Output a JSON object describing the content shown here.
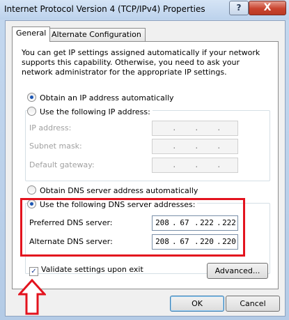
{
  "window": {
    "title": "Internet Protocol Version 4 (TCP/IPv4) Properties",
    "help_label": "?",
    "close_label": "X"
  },
  "tabs": [
    {
      "label": "General",
      "active": true
    },
    {
      "label": "Alternate Configuration",
      "active": false
    }
  ],
  "info_text": "You can get IP settings assigned automatically if your network supports this capability. Otherwise, you need to ask your network administrator for the appropriate IP settings.",
  "ip_section": {
    "auto_label": "Obtain an IP address automatically",
    "manual_label": "Use the following IP address:",
    "selected": "auto",
    "fields": [
      {
        "label": "IP address:",
        "value": [
          "",
          "",
          "",
          ""
        ]
      },
      {
        "label": "Subnet mask:",
        "value": [
          "",
          "",
          "",
          ""
        ]
      },
      {
        "label": "Default gateway:",
        "value": [
          "",
          "",
          "",
          ""
        ]
      }
    ]
  },
  "dns_section": {
    "auto_label": "Obtain DNS server address automatically",
    "manual_label": "Use the following DNS server addresses:",
    "selected": "manual",
    "preferred": {
      "label": "Preferred DNS server:",
      "value": [
        "208",
        "67",
        "222",
        "222"
      ]
    },
    "alternate": {
      "label": "Alternate DNS server:",
      "value": [
        "208",
        "67",
        "220",
        "220"
      ]
    }
  },
  "validate": {
    "label": "Validate settings upon exit",
    "checked": true,
    "check_glyph": "✓"
  },
  "buttons": {
    "advanced": "Advanced...",
    "ok": "OK",
    "cancel": "Cancel"
  },
  "annotation": {
    "highlight_color": "#e3131e",
    "arrow_icon": "up-arrow-icon"
  }
}
